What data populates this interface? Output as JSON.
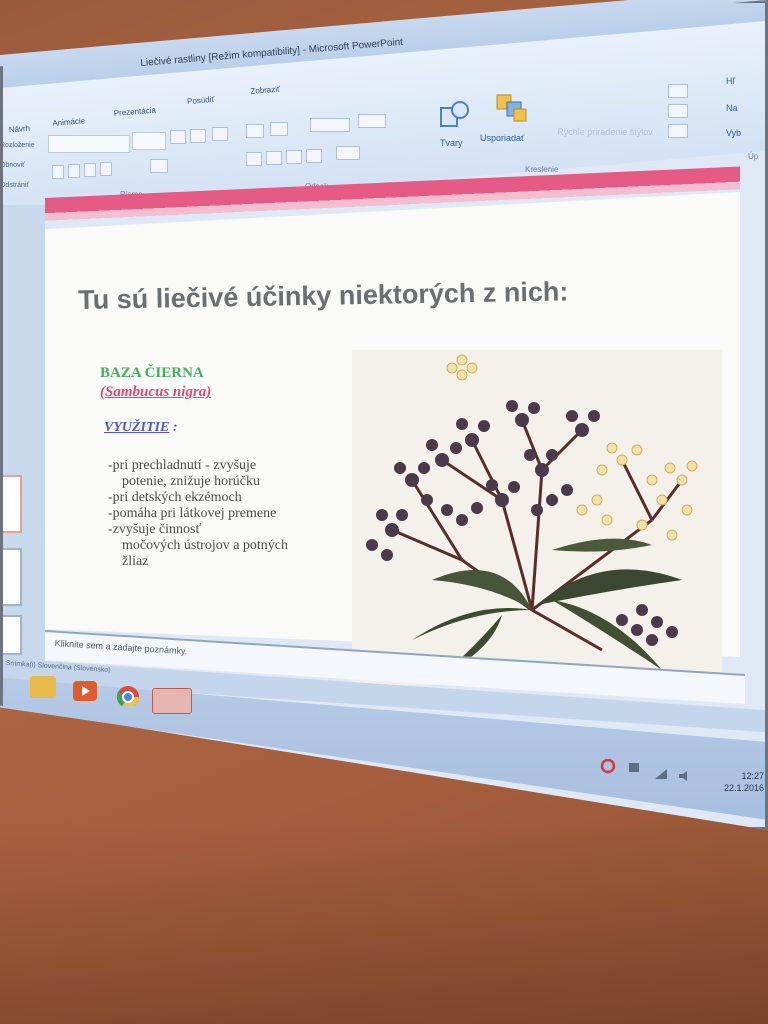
{
  "window": {
    "title": "Liečivé rastliny [Režim kompatibility] - Microsoft PowerPoint"
  },
  "ribbon": {
    "tabs": [
      "Návrh",
      "Animácie",
      "Prezentácia",
      "Posúdiť",
      "Zobraziť"
    ],
    "left_labels": [
      "Rozloženie",
      "Obnoviť",
      "Odstrániť"
    ],
    "buttons": {
      "shapes": "Tvary",
      "arrange": "Usporiadať",
      "quick_styles": "Rýchle priradenie štýlov",
      "right_partial": [
        "Hľ",
        "Na",
        "Vyb"
      ]
    },
    "groups": {
      "font": "Písmo",
      "paragraph": "Odsek",
      "drawing": "Kreslenie",
      "editing": "Úp"
    }
  },
  "slide": {
    "title": "Tu sú liečivé účinky niektorých z nich:",
    "plant_name": "BAZA ČIERNA",
    "latin_name": "(Sambucus nigra)",
    "usage_label": "VYUŽITIE",
    "usage_suffix": " :",
    "bullets": [
      "-pri prechladnutí - zvyšuje",
      "potenie, znižuje horúčku",
      "-pri detských ekzémoch",
      "-pomáha pri látkovej premene",
      "-zvyšuje činnosť",
      "močových  ústrojov a potných",
      "žliaz"
    ]
  },
  "notes": {
    "placeholder": "Kliknite sem a zadajte poznámky."
  },
  "statusbar": {
    "text": "Snímka(i)     Slovenčina (Slovensko)"
  },
  "taskbar": {
    "apps": [
      "file-explorer-icon",
      "media-player-icon",
      "chrome-icon",
      "powerpoint-icon"
    ],
    "clock_time": "12:27",
    "clock_date": "22.1.2016"
  },
  "colors": {
    "accent_pink": "#e65b86",
    "title_gray": "#6b6f72",
    "green": "#3fb05b",
    "blue_label": "#4f57c8"
  }
}
